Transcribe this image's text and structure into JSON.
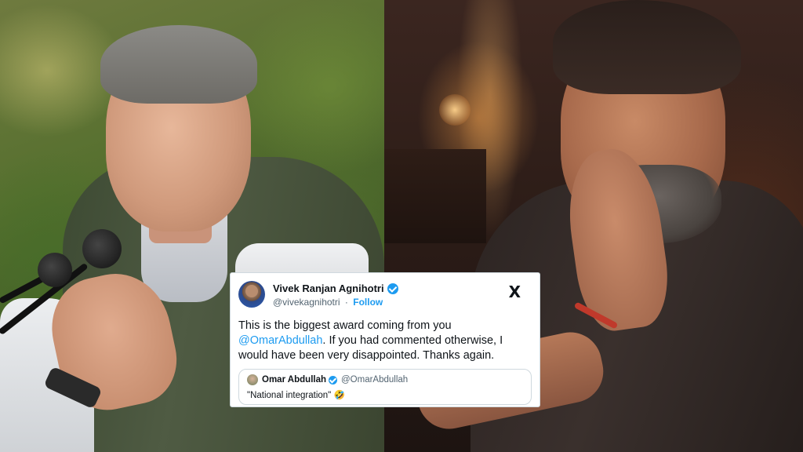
{
  "tweet": {
    "author_name": "Vivek Ranjan Agnihotri",
    "author_handle": "@vivekagnihotri",
    "separator": "·",
    "follow_label": "Follow",
    "platform_logo": "X",
    "text_before_mention": "This is the biggest award coming from you ",
    "mention": "@OmarAbdullah",
    "text_after_mention": ". If you had commented otherwise, I would have been very disappointed. Thanks again.",
    "verified_icon": "verified-badge-icon",
    "accent_color": "#1d9bf0"
  },
  "quoted_tweet": {
    "author_name": "Omar Abdullah",
    "author_handle": "@OmarAbdullah",
    "text": "\"National integration\"",
    "emoji": "🤣"
  },
  "images": {
    "left": "photo-omar-abdullah-speaking",
    "right": "photo-vivek-agnihotri-portrait"
  }
}
